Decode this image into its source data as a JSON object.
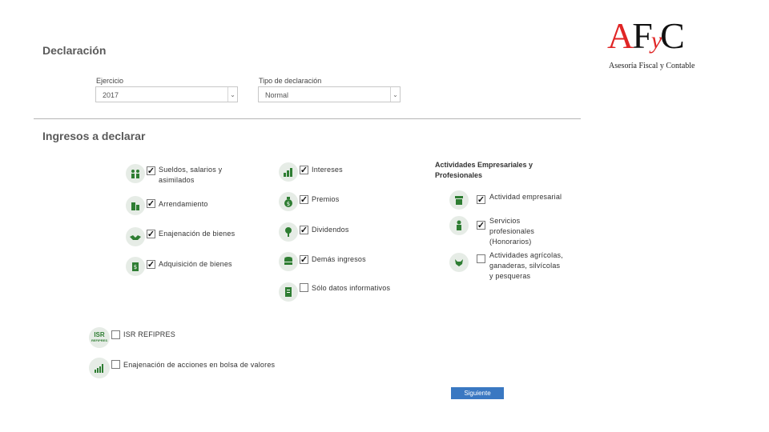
{
  "logo": {
    "letters": {
      "a": "A",
      "f": "F",
      "y": "y",
      "c": "C"
    },
    "subtitle": "Asesoría Fiscal y Contable"
  },
  "declaracion": {
    "title": "Declaración",
    "ejercicio": {
      "label": "Ejercicio",
      "value": "2017"
    },
    "tipo": {
      "label": "Tipo de declaración",
      "value": "Normal"
    }
  },
  "ingresos": {
    "title": "Ingresos a declarar",
    "col1": [
      {
        "label": "Sueldos, salarios y asimilados",
        "checked": true,
        "icon": "people-icon"
      },
      {
        "label": "Arrendamiento",
        "checked": true,
        "icon": "building-icon"
      },
      {
        "label": "Enajenación de bienes",
        "checked": true,
        "icon": "handshake-icon"
      },
      {
        "label": "Adquisición de bienes",
        "checked": true,
        "icon": "money-hand-icon"
      }
    ],
    "col2": [
      {
        "label": "Intereses",
        "checked": true,
        "icon": "growth-chart-icon"
      },
      {
        "label": "Premios",
        "checked": true,
        "icon": "money-bag-icon"
      },
      {
        "label": "Dividendos",
        "checked": true,
        "icon": "money-tree-icon"
      },
      {
        "label": "Demás ingresos",
        "checked": true,
        "icon": "coins-stack-icon"
      },
      {
        "label": "Sólo datos informativos",
        "checked": false,
        "icon": "document-icon"
      }
    ],
    "col3_heading": "Actividades Empresariales y Profesionales",
    "col3": [
      {
        "label": "Actividad empresarial",
        "checked": true,
        "icon": "store-icon"
      },
      {
        "label": "Servicios profesionales (Honorarios)",
        "checked": true,
        "icon": "professional-icon"
      },
      {
        "label": "Actividades agrícolas, ganaderas, silvícolas y pesqueras",
        "checked": false,
        "icon": "livestock-icon"
      }
    ],
    "extra": [
      {
        "label": "ISR REFIPRES",
        "checked": false,
        "icon": "isr-refipres-icon",
        "icon_text": "ISR",
        "icon_subtext": "REFIPRES"
      },
      {
        "label": "Enajenación de acciones en bolsa de valores",
        "checked": false,
        "icon": "stock-chart-icon"
      }
    ]
  },
  "actions": {
    "next_label": "Siguiente"
  },
  "colors": {
    "icon_green": "#2e7d32",
    "icon_bg": "#e6ece6",
    "button_blue": "#3a78c2",
    "logo_red": "#e02525"
  }
}
